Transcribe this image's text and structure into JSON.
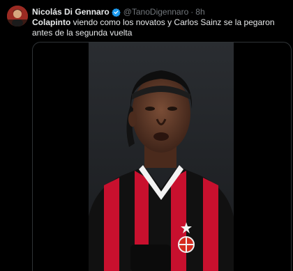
{
  "author": {
    "name": "Nicolás Di Gennaro",
    "handle": "@TanoDigennaro",
    "separator": "·",
    "time": "8h",
    "verified_icon": "verified-badge-icon",
    "verified_color": "#1d9bf0"
  },
  "tweet": {
    "mention": "Colapinto",
    "body": " viendo como los novatos y Carlos Sainz se la pegaron antes de la segunda vuelta"
  },
  "media": {
    "type": "video",
    "icon": "video-thumbnail",
    "jersey_colors": [
      "#c8102e",
      "#111111"
    ]
  },
  "colors": {
    "background": "#000000",
    "text": "#e7e9ea",
    "muted": "#71767b",
    "border": "#2f3336"
  }
}
